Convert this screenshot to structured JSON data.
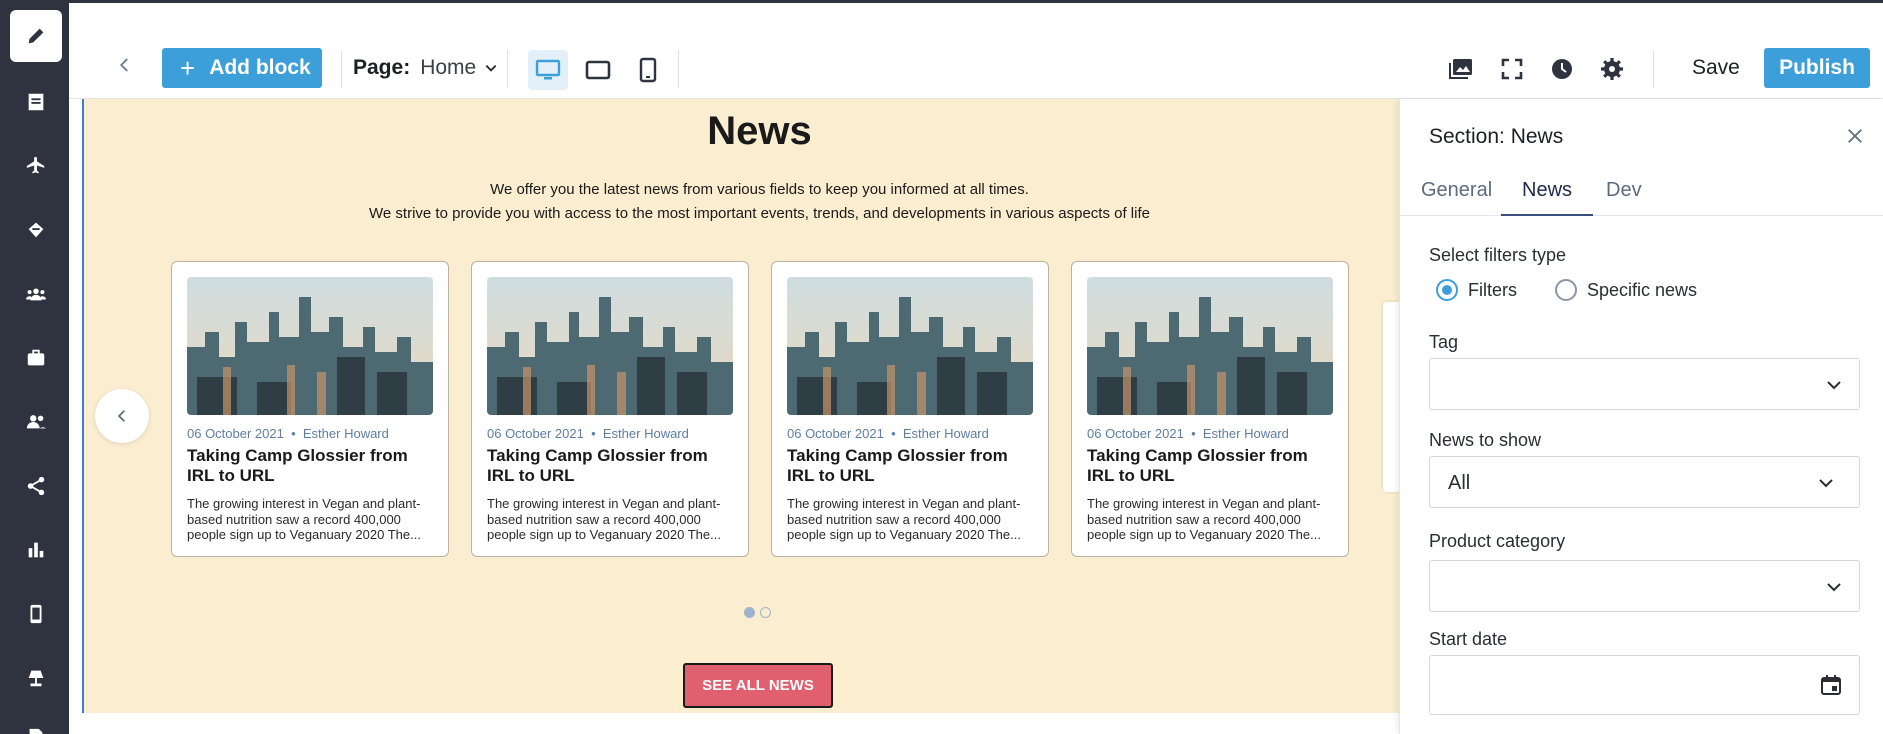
{
  "toolbar": {
    "add_block_label": "Add block",
    "page_label": "Page:",
    "page_value": "Home",
    "save_label": "Save",
    "publish_label": "Publish"
  },
  "section": {
    "title": "News",
    "subtitle_line1": "We offer you the latest news from various fields to keep you informed at all times.",
    "subtitle_line2": "We strive to provide you with access to the most important events, trends, and developments in various aspects of life",
    "cards": [
      {
        "date": "06 October 2021",
        "author": "Esther Howard",
        "title": "Taking Camp Glossier from IRL to URL",
        "desc": "The growing interest in Vegan and plant-based nutrition saw a record 400,000 people sign up to Veganuary 2020 The..."
      },
      {
        "date": "06 October 2021",
        "author": "Esther Howard",
        "title": "Taking Camp Glossier from IRL to URL",
        "desc": "The growing interest in Vegan and plant-based nutrition saw a record 400,000 people sign up to Veganuary 2020 The..."
      },
      {
        "date": "06 October 2021",
        "author": "Esther Howard",
        "title": "Taking Camp Glossier from IRL to URL",
        "desc": "The growing interest in Vegan and plant-based nutrition saw a record 400,000 people sign up to Veganuary 2020 The..."
      },
      {
        "date": "06 October 2021",
        "author": "Esther Howard",
        "title": "Taking Camp Glossier from IRL to URL",
        "desc": "The growing interest in Vegan and plant-based nutrition saw a record 400,000 people sign up to Veganuary 2020 The..."
      }
    ],
    "meta_separator": "•",
    "see_all_label": "SEE ALL NEWS",
    "pagination": {
      "pages": 2,
      "current": 1
    }
  },
  "panel": {
    "title": "Section: News",
    "tabs": [
      "General",
      "News",
      "Dev"
    ],
    "active_tab": "News",
    "filters_type_label": "Select filters type",
    "radio_filters": "Filters",
    "radio_specific": "Specific news",
    "tag_label": "Tag",
    "tag_value": "",
    "news_to_show_label": "News to show",
    "news_to_show_value": "All",
    "product_category_label": "Product category",
    "product_category_value": "",
    "start_date_label": "Start date",
    "start_date_value": ""
  },
  "rail_icons": [
    "pencil-icon",
    "document-icon",
    "airplane-icon",
    "handshake-icon",
    "group-icon",
    "briefcase-icon",
    "people-icon",
    "share-icon",
    "bar-chart-icon",
    "mobile-icon",
    "lamp-icon",
    "file-icon"
  ],
  "colors": {
    "accent": "#3d9fda",
    "rail": "#2f3340",
    "canvas": "#faedd0",
    "see_all": "#e06070"
  }
}
